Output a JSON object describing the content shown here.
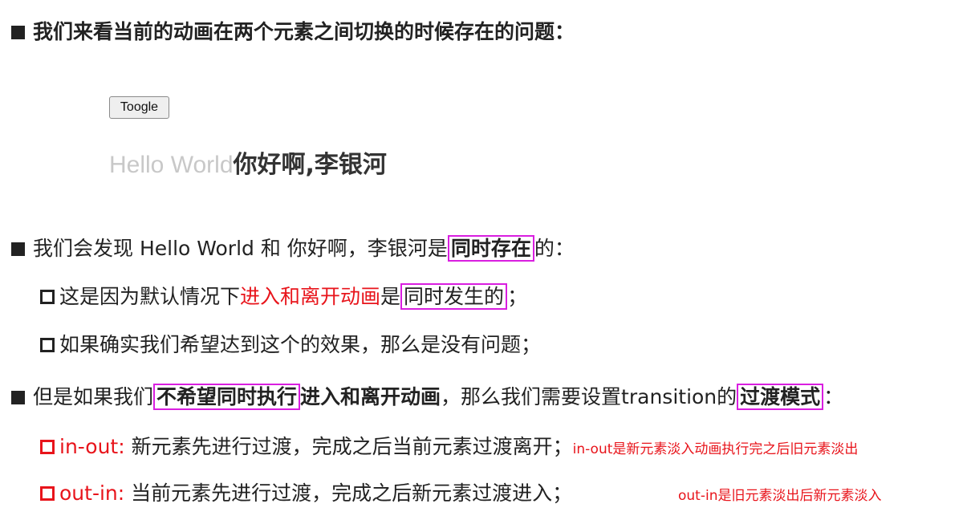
{
  "heading": "我们来看当前的动画在两个元素之间切换的时候存在的问题：",
  "demo": {
    "button_label": "Toogle",
    "hello_text": "Hello World",
    "nihao_text": "你好啊,李银河"
  },
  "bullet1": {
    "prefix": "我们会发现 Hello World 和 你好啊，李银河是",
    "highlight": "同时存在",
    "suffix": "的："
  },
  "sub1": {
    "prefix": "这是因为默认情况下",
    "red": "进入和离开动画",
    "mid": "是",
    "highlight": "同时发生的",
    "suffix": "；"
  },
  "sub2": {
    "text": "如果确实我们希望达到这个的效果，那么是没有问题；"
  },
  "bullet2": {
    "prefix": "但是如果我们",
    "highlight1": "不希望同时执行",
    "bold": "进入和离开动画",
    "mid": "，那么我们需要设置transition的",
    "highlight2": "过渡模式",
    "suffix": "："
  },
  "mode1": {
    "name": "in-out:",
    "desc": "新元素先进行过渡，完成之后当前元素过渡离开；",
    "note": "in-out是新元素淡入动画执行完之后旧元素淡出"
  },
  "mode2": {
    "name": "out-in:",
    "desc": "当前元素先进行过渡，完成之后新元素过渡进入；",
    "note": "out-in是旧元素淡出后新元素淡入"
  },
  "colors": {
    "accent_red": "#e8141b",
    "highlight_box": "#d91ee0",
    "text": "#222222"
  }
}
